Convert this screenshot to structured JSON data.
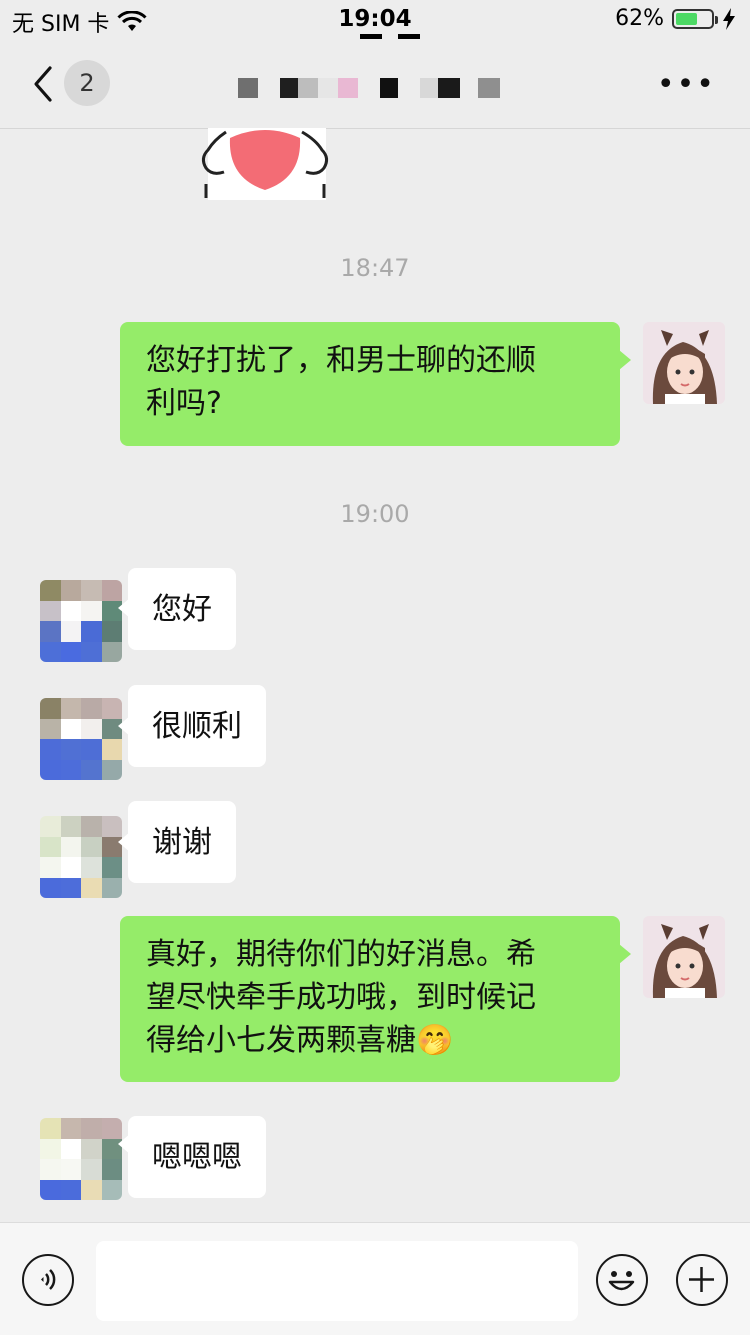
{
  "status_bar": {
    "carrier": "无 SIM 卡",
    "time": "19:04",
    "battery_percent": "62%",
    "battery_level": 0.62,
    "battery_color": "#4cd964"
  },
  "nav": {
    "back_icon": "chevron-left-icon",
    "unread_count": "2",
    "title_blurred": true,
    "more_label": "•••"
  },
  "messages": [
    {
      "type": "sticker",
      "from": "other"
    },
    {
      "type": "timestamp",
      "text": "18:47"
    },
    {
      "type": "text",
      "from": "me",
      "lines": [
        "您好打扰了，和男士聊的还顺",
        "利吗?"
      ]
    },
    {
      "type": "timestamp",
      "text": "19:00"
    },
    {
      "type": "text",
      "from": "other",
      "text": "您好"
    },
    {
      "type": "text",
      "from": "other",
      "text": "很顺利"
    },
    {
      "type": "text",
      "from": "other",
      "text": "谢谢"
    },
    {
      "type": "text",
      "from": "me",
      "lines": [
        "真好，期待你们的好消息。希",
        "望尽快牵手成功哦，到时候记",
        "得给小七发两颗喜糖"
      ],
      "emoji": "🤭"
    },
    {
      "type": "text",
      "from": "other",
      "text": "嗯嗯嗯"
    }
  ],
  "input_bar": {
    "voice_icon": "voice-icon",
    "input_value": "",
    "emoji_icon": "smiley-icon",
    "plus_icon": "plus-icon"
  },
  "colors": {
    "background": "#ededed",
    "my_bubble": "#95ec69",
    "their_bubble": "#ffffff",
    "timestamp": "#a9a9a9"
  }
}
